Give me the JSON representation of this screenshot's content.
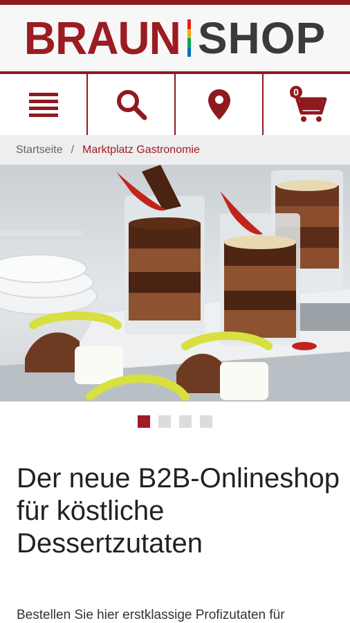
{
  "brand": {
    "name_left": "BRAUN",
    "name_right": "SHOP",
    "primary_color": "#8e1a1f",
    "accent_colors": [
      "#e2231a",
      "#f6a800",
      "#00a651",
      "#0071bc"
    ]
  },
  "nav": {
    "items": [
      {
        "icon": "menu-icon"
      },
      {
        "icon": "search-icon"
      },
      {
        "icon": "location-pin-icon"
      },
      {
        "icon": "cart-icon",
        "badge": "0"
      }
    ]
  },
  "breadcrumb": {
    "home": "Startseite",
    "separator": "/",
    "current": "Marktplatz Gastronomie"
  },
  "carousel": {
    "slide_count": 4,
    "active_index": 0
  },
  "content": {
    "headline": "Der neue B2B-Onlineshop für köstliche Dessertzutaten",
    "subtext": "Bestellen Sie hier erstklassige Profizutaten für"
  }
}
